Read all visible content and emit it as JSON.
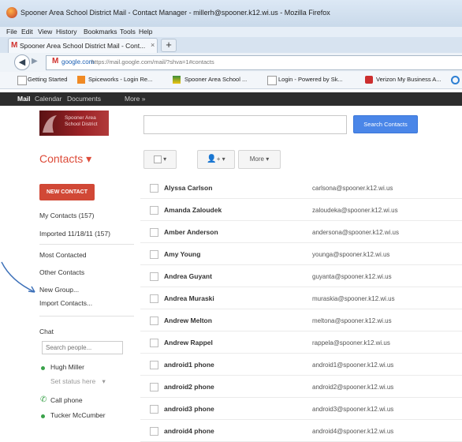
{
  "window": {
    "title": "Spooner Area School District Mail - Contact Manager - millerh@spooner.k12.wi.us - Mozilla Firefox"
  },
  "menu": [
    "File",
    "Edit",
    "View",
    "History",
    "Bookmarks",
    "Tools",
    "Help"
  ],
  "tab": {
    "label": "Spooner Area School District Mail - Cont...",
    "close": "×",
    "new_tab": "+"
  },
  "nav": {
    "site": "google.com",
    "url": "https://mail.google.com/mail/?shva=1#contacts"
  },
  "bookmarks": [
    "Getting Started",
    "Spiceworks - Login Re...",
    "Spooner Area School ...",
    "Login - Powered by Sk...",
    "Verizon My Business A..."
  ],
  "gbar": [
    "Mail",
    "Calendar",
    "Documents",
    "More »"
  ],
  "logo": {
    "line1": "Spooner Area",
    "line2": "School District"
  },
  "search": {
    "button": "Search Contacts",
    "value": ""
  },
  "contacts_title": "Contacts ▾",
  "toolbar": {
    "more": "More ▾",
    "caret": "▾",
    "add_person": "+"
  },
  "left_nav": {
    "new_contact": "NEW CONTACT",
    "my_contacts": "My Contacts (157)",
    "imported": "Imported 11/18/11 (157)",
    "most_contacted": "Most Contacted",
    "other_contacts": "Other Contacts",
    "new_group": "New Group...",
    "import_contacts": "Import Contacts..."
  },
  "chat": {
    "title": "Chat",
    "search_placeholder": "Search people...",
    "user": "Hugh Miller",
    "status": "Set status here",
    "status_caret": "▾",
    "call_phone": "Call phone",
    "contact": "Tucker McCumber"
  },
  "contacts": [
    {
      "name": "Alyssa Carlson",
      "email": "carlsona@spooner.k12.wi.us"
    },
    {
      "name": "Amanda Zaloudek",
      "email": "zaloudeka@spooner.k12.wi.us"
    },
    {
      "name": "Amber Anderson",
      "email": "andersona@spooner.k12.wi.us"
    },
    {
      "name": "Amy Young",
      "email": "younga@spooner.k12.wi.us"
    },
    {
      "name": "Andrea Guyant",
      "email": "guyanta@spooner.k12.wi.us"
    },
    {
      "name": "Andrea Muraski",
      "email": "muraskia@spooner.k12.wi.us"
    },
    {
      "name": "Andrew Melton",
      "email": "meltona@spooner.k12.wi.us"
    },
    {
      "name": "Andrew Rappel",
      "email": "rappela@spooner.k12.wi.us"
    },
    {
      "name": "android1 phone",
      "email": "android1@spooner.k12.wi.us"
    },
    {
      "name": "android2 phone",
      "email": "android2@spooner.k12.wi.us"
    },
    {
      "name": "android3 phone",
      "email": "android3@spooner.k12.wi.us"
    },
    {
      "name": "android4 phone",
      "email": "android4@spooner.k12.wi.us"
    }
  ],
  "colors": {
    "accent_red": "#dd4b39",
    "new_contact": "#d14836",
    "search_blue": "#4a86e8",
    "online_green": "#3aa24a",
    "annotation_arrow": "#3b6fb8"
  }
}
